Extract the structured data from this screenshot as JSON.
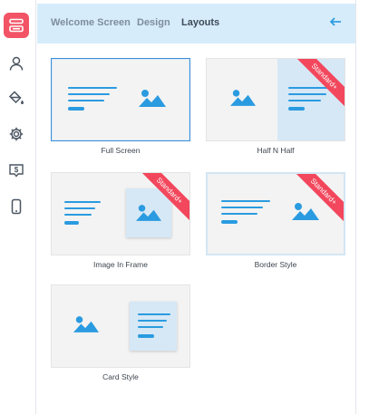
{
  "tabs": {
    "welcome": "Welcome Screen",
    "design": "Design",
    "layouts": "Layouts"
  },
  "sidebar_icons": [
    "layout-icon",
    "user-icon",
    "paint-bucket-icon",
    "gear-icon",
    "dollar-tag-icon",
    "mobile-icon"
  ],
  "layouts": {
    "full_screen": "Full Screen",
    "half_n_half": "Half N Half",
    "image_in_frame": "Image In Frame",
    "border_style": "Border Style",
    "card_style": "Card Style"
  },
  "badge": "Standard+",
  "colors": {
    "accent": "#2a9be0",
    "active_rail": "#f25466",
    "ribbon": "#f2475c",
    "tabbar": "#d6ecfb"
  }
}
